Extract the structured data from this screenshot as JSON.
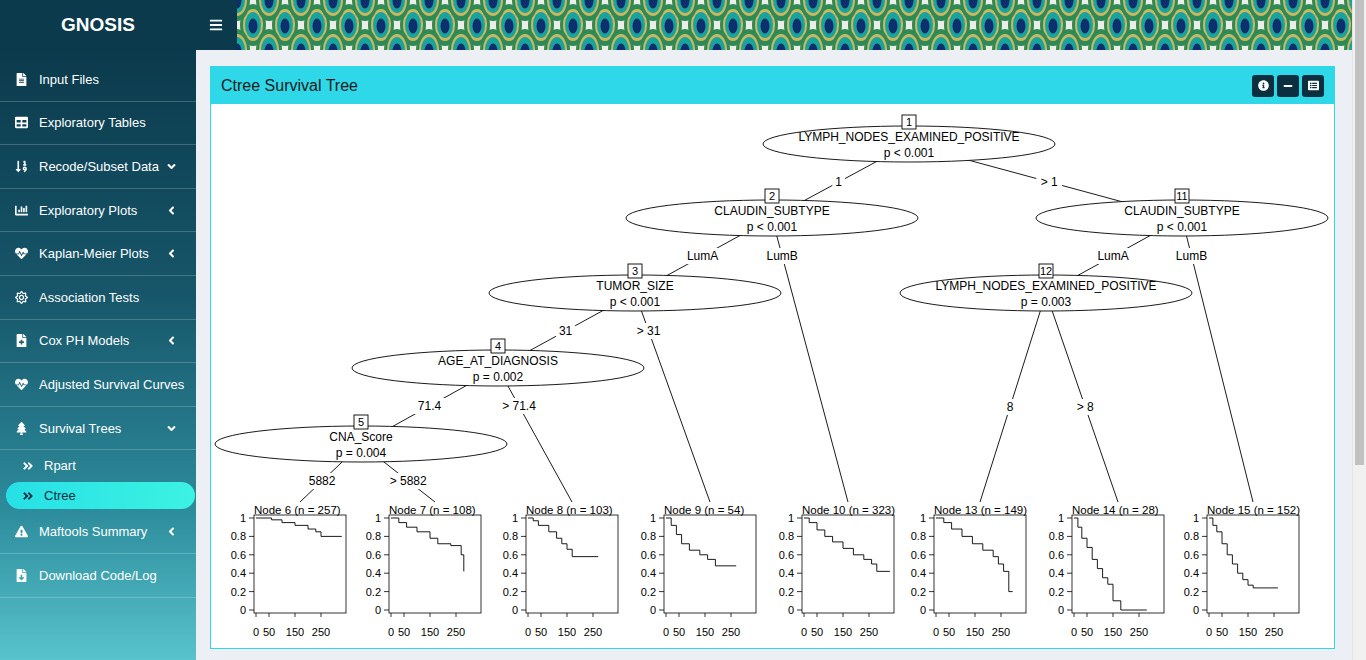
{
  "app": {
    "title": "GNOSIS"
  },
  "sidebar": {
    "items": [
      {
        "label": "Input Files",
        "expandable": false,
        "expanded": false,
        "children": []
      },
      {
        "label": "Exploratory Tables",
        "expandable": false,
        "expanded": false,
        "children": []
      },
      {
        "label": "Recode/Subset Data",
        "expandable": true,
        "expanded": true,
        "children": []
      },
      {
        "label": "Exploratory Plots",
        "expandable": true,
        "expanded": false,
        "children": []
      },
      {
        "label": "Kaplan-Meier Plots",
        "expandable": true,
        "expanded": false,
        "children": []
      },
      {
        "label": "Association Tests",
        "expandable": false,
        "expanded": false,
        "children": []
      },
      {
        "label": "Cox PH Models",
        "expandable": true,
        "expanded": false,
        "children": []
      },
      {
        "label": "Adjusted Survival Curves",
        "expandable": false,
        "expanded": false,
        "children": []
      },
      {
        "label": "Survival Trees",
        "expandable": true,
        "expanded": true,
        "children": [
          {
            "label": "Rpart",
            "selected": false
          },
          {
            "label": "Ctree",
            "selected": true
          }
        ]
      },
      {
        "label": "Maftools Summary",
        "expandable": true,
        "expanded": false,
        "children": []
      },
      {
        "label": "Download Code/Log",
        "expandable": false,
        "expanded": false,
        "children": []
      }
    ]
  },
  "panel": {
    "title": "Ctree Survival Tree"
  },
  "tree": {
    "inner_nodes": [
      {
        "id": "1",
        "variable": "LYMPH_NODES_EXAMINED_POSITIVE",
        "p": "p < 0.001"
      },
      {
        "id": "2",
        "variable": "CLAUDIN_SUBTYPE",
        "p": "p < 0.001"
      },
      {
        "id": "3",
        "variable": "TUMOR_SIZE",
        "p": "p < 0.001"
      },
      {
        "id": "4",
        "variable": "AGE_AT_DIAGNOSIS",
        "p": "p = 0.002"
      },
      {
        "id": "5",
        "variable": "CNA_Score",
        "p": "p = 0.004"
      },
      {
        "id": "11",
        "variable": "CLAUDIN_SUBTYPE",
        "p": "p < 0.001"
      },
      {
        "id": "12",
        "variable": "LYMPH_NODES_EXAMINED_POSITIVE",
        "p": "p = 0.003"
      }
    ],
    "edges": [
      {
        "from": "1",
        "to": "2",
        "label": "1"
      },
      {
        "from": "1",
        "to": "11",
        "label": "> 1"
      },
      {
        "from": "2",
        "to": "3",
        "label": "LumA"
      },
      {
        "from": "2",
        "to": "10",
        "label": "LumB"
      },
      {
        "from": "3",
        "to": "4",
        "label": "31"
      },
      {
        "from": "3",
        "to": "9",
        "label": "> 31"
      },
      {
        "from": "4",
        "to": "5",
        "label": "71.4"
      },
      {
        "from": "4",
        "to": "8",
        "label": "> 71.4"
      },
      {
        "from": "5",
        "to": "6",
        "label": "5882"
      },
      {
        "from": "5",
        "to": "7",
        "label": "> 5882"
      },
      {
        "from": "11",
        "to": "12",
        "label": "LumA"
      },
      {
        "from": "11",
        "to": "15",
        "label": "LumB"
      },
      {
        "from": "12",
        "to": "13",
        "label": "8"
      },
      {
        "from": "12",
        "to": "14",
        "label": "> 8"
      }
    ],
    "axis": {
      "y_ticks": [
        "1",
        "0.8",
        "0.6",
        "0.4",
        "0.2",
        "0"
      ],
      "x_ticks": [
        "0",
        "50",
        "150",
        "250"
      ]
    },
    "terminal_nodes": [
      {
        "id": "6",
        "title": "Node 6 (n = 257)",
        "times": [
          0,
          60,
          100,
          150,
          200,
          230,
          250,
          330
        ],
        "survival": [
          1,
          0.98,
          0.95,
          0.92,
          0.88,
          0.85,
          0.8,
          0.8
        ]
      },
      {
        "id": "7",
        "title": "Node 7 (n = 108)",
        "times": [
          0,
          30,
          60,
          100,
          150,
          180,
          230,
          270,
          280
        ],
        "survival": [
          1,
          0.95,
          0.9,
          0.85,
          0.78,
          0.72,
          0.7,
          0.6,
          0.42
        ]
      },
      {
        "id": "8",
        "title": "Node 8 (n = 103)",
        "times": [
          0,
          20,
          40,
          80,
          110,
          130,
          150,
          170,
          270
        ],
        "survival": [
          1,
          0.97,
          0.92,
          0.85,
          0.78,
          0.72,
          0.66,
          0.58,
          0.58
        ]
      },
      {
        "id": "9",
        "title": "Node 9 (n = 54)",
        "times": [
          0,
          20,
          40,
          60,
          90,
          130,
          160,
          190,
          270
        ],
        "survival": [
          1,
          0.92,
          0.82,
          0.72,
          0.65,
          0.6,
          0.55,
          0.48,
          0.48
        ]
      },
      {
        "id": "10",
        "title": "Node 10 (n = 323)",
        "times": [
          0,
          20,
          50,
          80,
          110,
          150,
          190,
          230,
          260,
          280,
          330
        ],
        "survival": [
          1,
          0.95,
          0.87,
          0.8,
          0.74,
          0.67,
          0.6,
          0.55,
          0.5,
          0.42,
          0.42
        ]
      },
      {
        "id": "13",
        "title": "Node 13 (n = 149)",
        "times": [
          0,
          30,
          60,
          100,
          140,
          180,
          220,
          240,
          260,
          280,
          295
        ],
        "survival": [
          1,
          0.95,
          0.88,
          0.8,
          0.72,
          0.65,
          0.58,
          0.5,
          0.42,
          0.2,
          0.2
        ]
      },
      {
        "id": "14",
        "title": "Node 14 (n = 28)",
        "times": [
          0,
          15,
          30,
          50,
          70,
          90,
          110,
          130,
          150,
          180,
          280
        ],
        "survival": [
          1,
          0.9,
          0.78,
          0.68,
          0.55,
          0.45,
          0.35,
          0.28,
          0.1,
          0,
          0
        ]
      },
      {
        "id": "15",
        "title": "Node 15 (n = 152)",
        "times": [
          0,
          15,
          30,
          50,
          70,
          90,
          110,
          130,
          150,
          170,
          265
        ],
        "survival": [
          1,
          0.92,
          0.85,
          0.72,
          0.6,
          0.5,
          0.4,
          0.33,
          0.27,
          0.24,
          0.24
        ]
      }
    ]
  }
}
